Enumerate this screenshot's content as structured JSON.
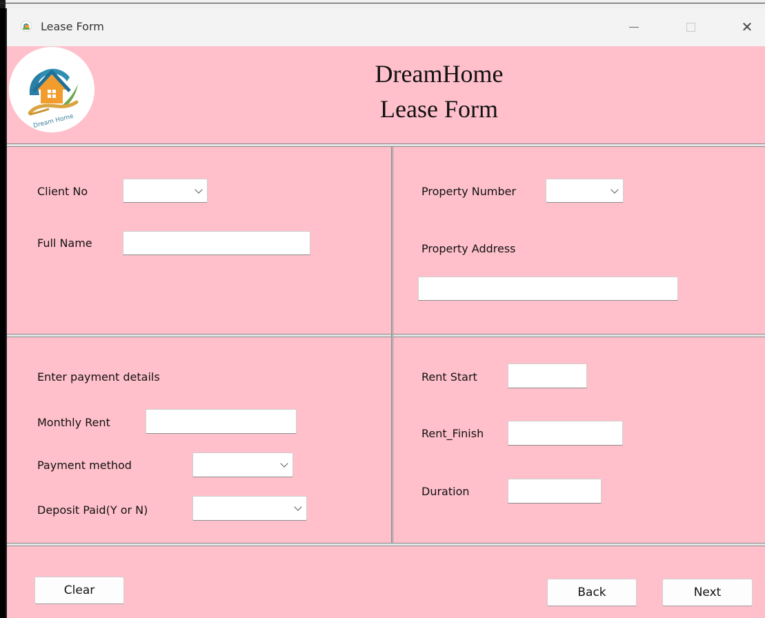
{
  "window": {
    "title": "Lease Form"
  },
  "header": {
    "title_line1": "DreamHome",
    "title_line2": "Lease Form",
    "logo_text": "Dream Home"
  },
  "client": {
    "client_no_label": "Client No",
    "client_no_value": "",
    "full_name_label": "Full Name",
    "full_name_value": ""
  },
  "property": {
    "number_label": "Property Number",
    "number_value": "",
    "address_label": "Property Address",
    "address_value": ""
  },
  "payment": {
    "heading": "Enter payment details",
    "monthly_rent_label": "Monthly Rent",
    "monthly_rent_value": "",
    "method_label": "Payment method",
    "method_value": "",
    "deposit_label": "Deposit Paid(Y or N)",
    "deposit_value": ""
  },
  "rent": {
    "start_label": "Rent Start",
    "start_value": "",
    "finish_label": "Rent_Finish",
    "finish_value": "",
    "duration_label": "Duration",
    "duration_value": ""
  },
  "buttons": {
    "clear": "Clear",
    "back": "Back",
    "next": "Next"
  },
  "colors": {
    "form_background": "#ffc0cb",
    "titlebar": "#f3f3f3"
  }
}
